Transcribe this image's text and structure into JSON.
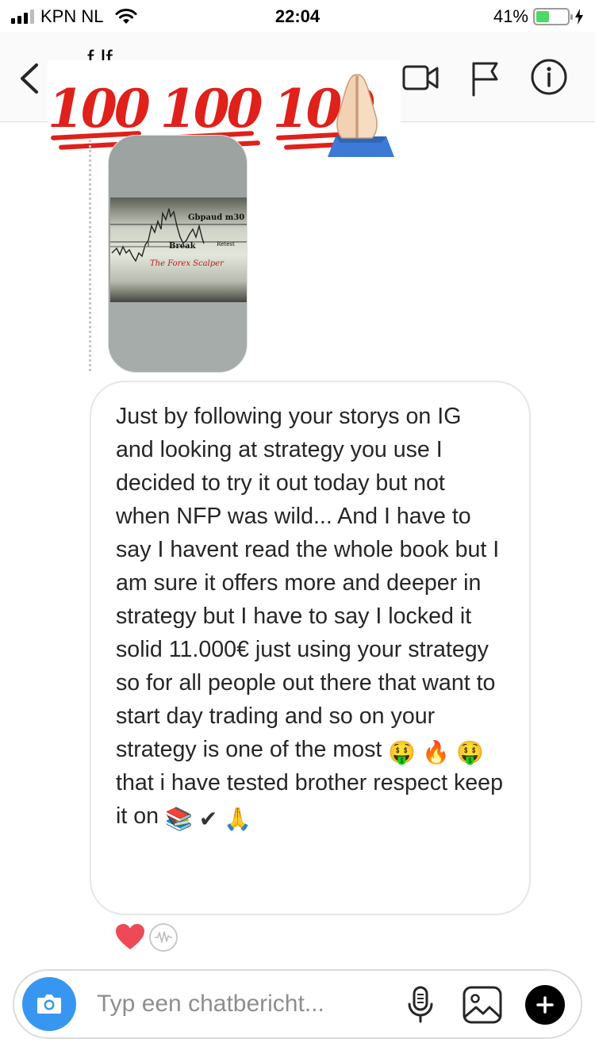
{
  "status_bar": {
    "carrier": "KPN NL",
    "time": "22:04",
    "battery_percent": "41%",
    "battery_level": 0.41,
    "signal_bars": 4,
    "signal_bars_active": 3
  },
  "header": {
    "back_icon": "chevron-left-icon",
    "title_partial": "f                 lf",
    "sticker": {
      "numbers": [
        "100",
        "100",
        "100"
      ],
      "emoji": "praying-hands"
    },
    "icons": [
      "video-camera-icon",
      "flag-icon",
      "info-icon"
    ]
  },
  "messages": {
    "image_message": {
      "chart_labels": {
        "pair": "Gbpaud m30",
        "break": "Break",
        "retest": "Retest",
        "signature": "The Forex Scalper"
      }
    },
    "text_message": {
      "text": "Just by following your storys on IG and looking at strategy you use I decided to try it out today but not when NFP was wild... And I have to say I havent read the whole book but I am sure it offers more and deeper in strategy but I have to say I locked it solid 11.000€ just using your strategy so for all people out there that want to start day trading and so on your strategy is one of the most",
      "emoji_1": "🤑",
      "emoji_2": "🔥",
      "emoji_3": "🤑",
      "text_after_emojis": "that i have tested brother respect keep it on",
      "emoji_4": "📚",
      "emoji_5": "✔",
      "emoji_6": "🙏"
    }
  },
  "reactions": {
    "heart_color": "#ed4956",
    "items": [
      "heart-icon",
      "wave-icon"
    ]
  },
  "composer": {
    "placeholder": "Typ een chatbericht...",
    "camera_color": "#3797f0",
    "icons": [
      "camera-icon",
      "microphone-icon",
      "gallery-icon",
      "plus-icon"
    ]
  }
}
